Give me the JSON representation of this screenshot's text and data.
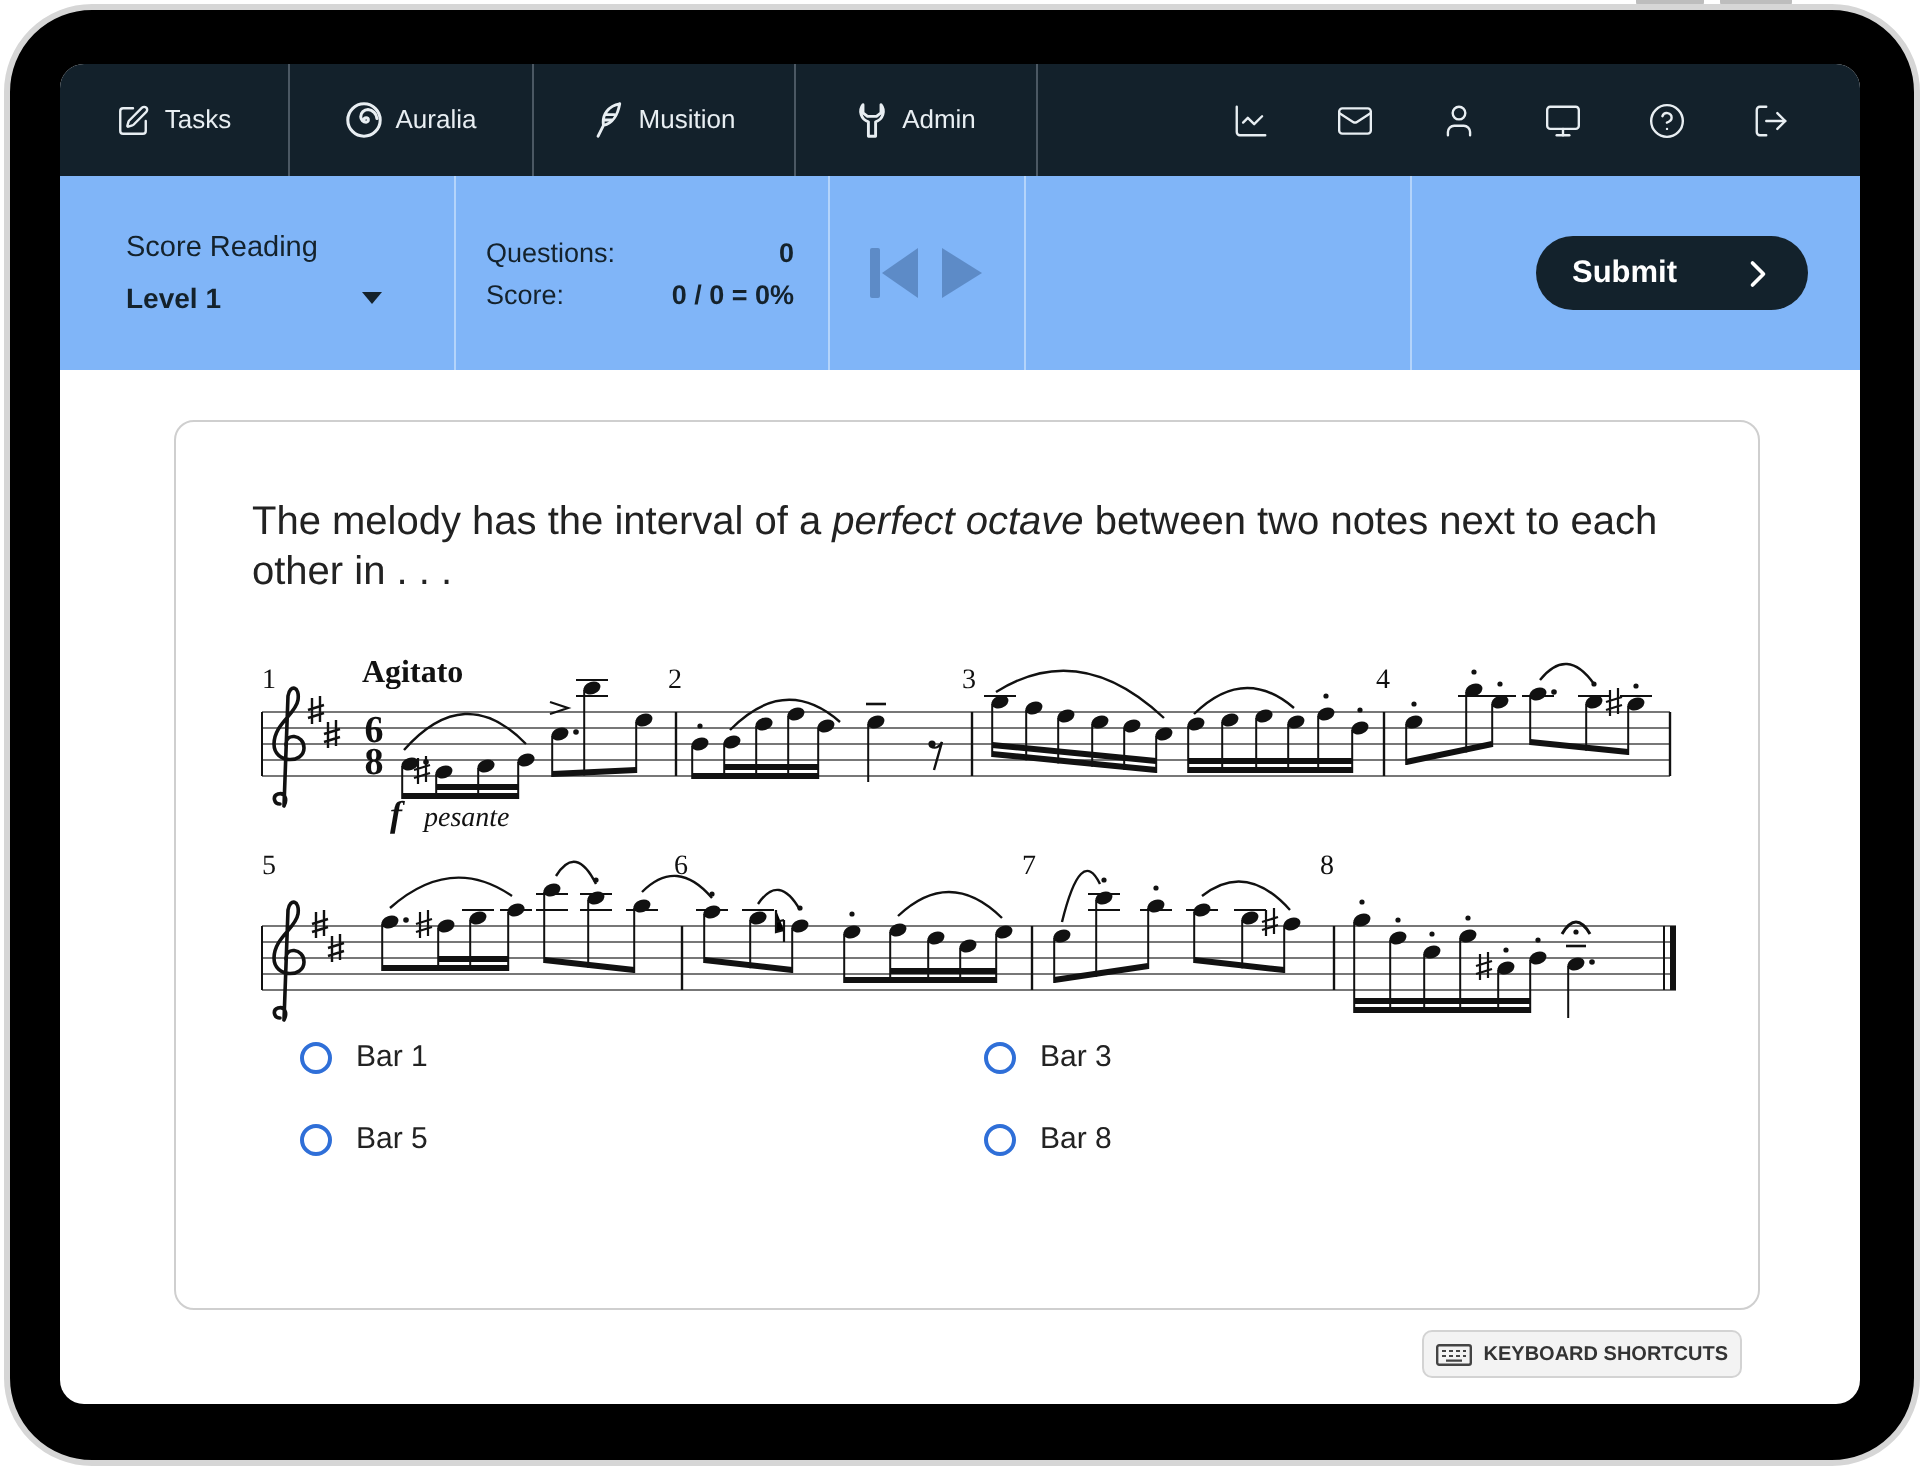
{
  "nav": {
    "items": [
      {
        "label": "Tasks",
        "selected": false
      },
      {
        "label": "Auralia",
        "selected": false
      },
      {
        "label": "Musition",
        "selected": false
      },
      {
        "label": "Admin",
        "selected": false
      }
    ]
  },
  "toolbar": {
    "exercise": "Score Reading",
    "level": {
      "value": "Level 1"
    },
    "stats": [
      {
        "label": "Questions:",
        "value": "0"
      },
      {
        "label": "Score:",
        "value": "0 / 0 = 0%"
      }
    ],
    "submit": "Submit"
  },
  "question": {
    "text": "The melody has the interval of a *perfect octave* between two notes next to each other in . . .",
    "score": {
      "tempo": "Agitato",
      "time_signature": [
        "6",
        "8"
      ],
      "dynamic": "f",
      "expression": "pesante",
      "bar_numbers": [
        "1",
        "2",
        "3",
        "4",
        "5",
        "6",
        "7",
        "8"
      ]
    },
    "options": [
      {
        "label": "Bar 1",
        "selected": false
      },
      {
        "label": "Bar 3",
        "selected": false
      },
      {
        "label": "Bar 5",
        "selected": false
      },
      {
        "label": "Bar 8",
        "selected": false
      }
    ]
  },
  "keyboard_shortcuts": "KEYBOARD SHORTCUTS"
}
